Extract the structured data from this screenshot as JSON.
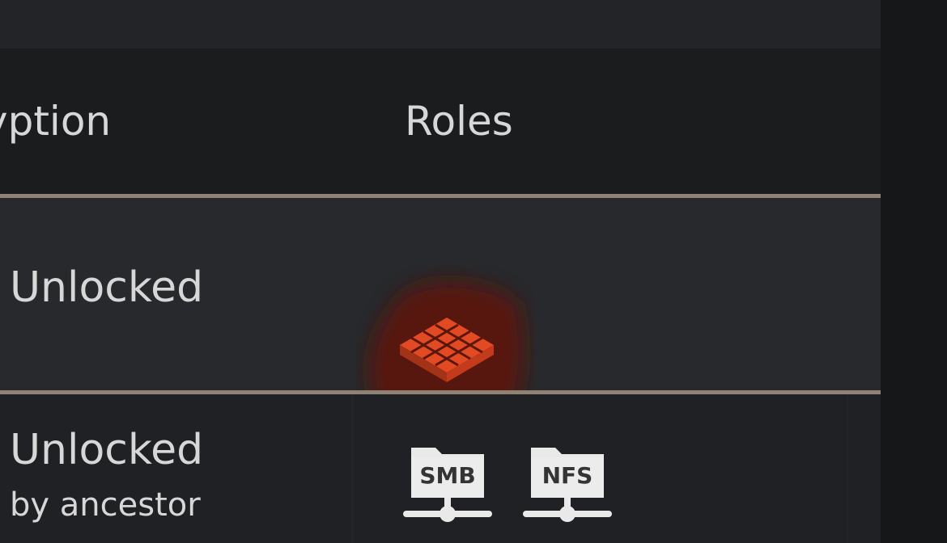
{
  "table": {
    "headers": {
      "encryption": "yption",
      "roles": "Roles"
    },
    "rows": [
      {
        "encryption": "Unlocked",
        "roles_icons": [
          "dataset-icon",
          "share-icon"
        ]
      },
      {
        "encryption": "Unlocked",
        "encryption_detail": "by ancestor",
        "roles_icons": [
          "smb-share-icon",
          "nfs-share-icon"
        ]
      }
    ]
  },
  "icons": {
    "smb_label": "SMB",
    "nfs_label": "NFS"
  },
  "colors": {
    "accent": "#e24a24",
    "accent_glow": "#5a1608",
    "divider": "#8f8174",
    "text": "#d7d7d7",
    "row_highlight": "#27292c",
    "background": "#1b1c1e"
  }
}
